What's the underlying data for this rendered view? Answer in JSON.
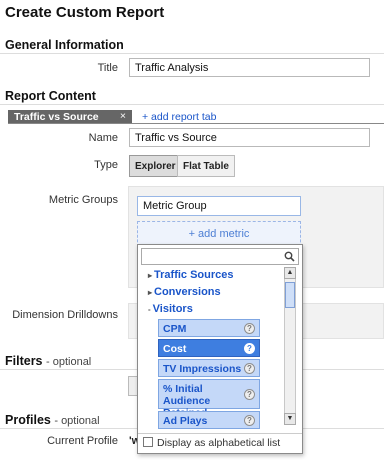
{
  "page": {
    "title": "Create Custom Report"
  },
  "general": {
    "heading": "General Information",
    "title_label": "Title",
    "title_value": "Traffic Analysis"
  },
  "content": {
    "heading": "Report Content",
    "tab_label": "Traffic vs Source",
    "tab_close": "×",
    "add_tab": "+ add report tab",
    "name_label": "Name",
    "name_value": "Traffic vs Source",
    "type_label": "Type",
    "type_options": [
      "Explorer",
      "Flat Table"
    ],
    "type_selected": "Explorer",
    "metric_groups_label": "Metric Groups",
    "metric_group_value": "Metric Group",
    "add_metric": "+ add metric",
    "dimension_label": "Dimension Drilldowns"
  },
  "metric_dropdown": {
    "search_placeholder": "",
    "categories": [
      {
        "label": "Traffic Sources",
        "expanded": false,
        "glyph": "▸"
      },
      {
        "label": "Conversions",
        "expanded": false,
        "glyph": "▸"
      },
      {
        "label": "Visitors",
        "expanded": true,
        "glyph": "-"
      }
    ],
    "metrics": [
      "CPM",
      "Cost",
      "TV Impressions",
      "% Initial Audience Retained",
      "Ad Plays"
    ],
    "selected_metric": "Cost",
    "info_glyph": "?",
    "alpha_checkbox": "Display as alphabetical list",
    "alpha_checked": false
  },
  "filters": {
    "heading": "Filters",
    "optional": "- optional"
  },
  "profiles": {
    "heading": "Profiles",
    "optional": "- optional",
    "current_label": "Current Profile",
    "current_value": "'w"
  },
  "colors": {
    "link": "#1a55c9",
    "metric_bg": "#c4d8f8",
    "metric_selected": "#3e7ee0",
    "tab_bg": "#666666"
  }
}
